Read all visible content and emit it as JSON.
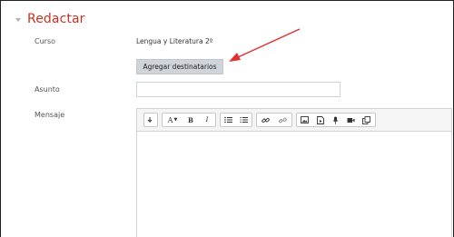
{
  "section": {
    "title": "Redactar"
  },
  "course": {
    "label": "Curso",
    "value": "Lengua y Literatura 2º"
  },
  "recipients": {
    "button_label": "Agregar destinatarios"
  },
  "subject": {
    "label": "Asunto",
    "value": ""
  },
  "message": {
    "label": "Mensaje",
    "value": ""
  },
  "toolbar": {
    "items": [
      "collapse",
      "font-color",
      "bold",
      "italic",
      "unordered-list",
      "ordered-list",
      "link",
      "unlink",
      "image",
      "media",
      "record-audio",
      "record-video",
      "manage-files"
    ],
    "labels": {
      "font_color": "A",
      "bold": "B",
      "italic": "I"
    }
  },
  "colors": {
    "accent": "#ca3120",
    "button_bg": "#ced4da",
    "annotation_arrow": "#e03030"
  }
}
